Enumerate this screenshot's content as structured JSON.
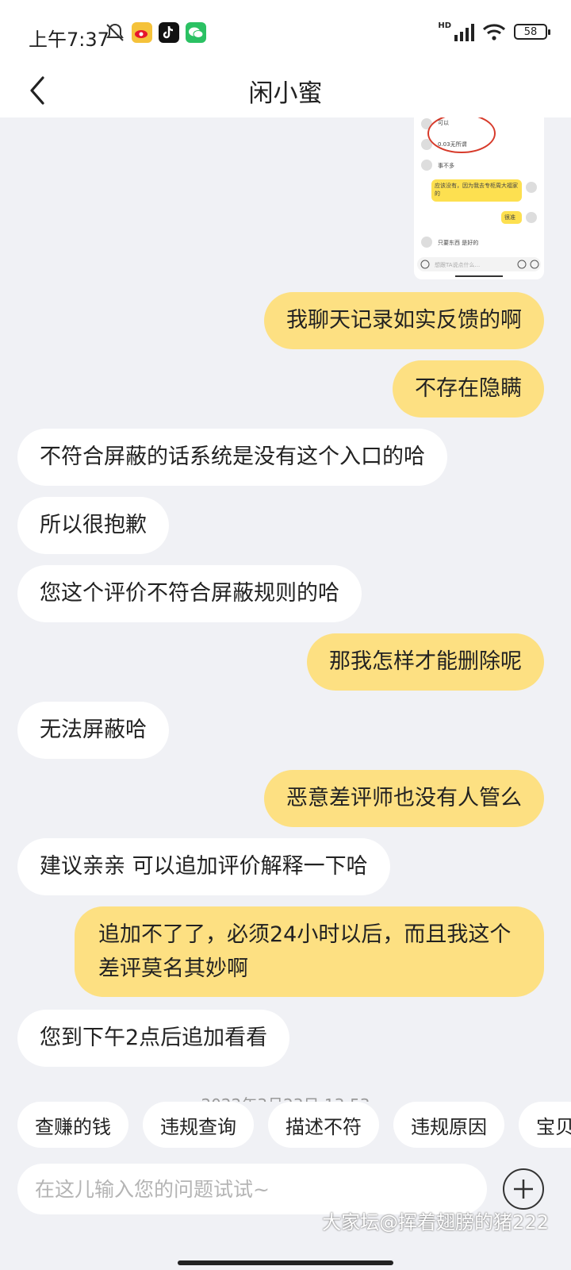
{
  "status_bar": {
    "time": "上午7:37",
    "network": "HD",
    "battery": "58",
    "icons": [
      "mute-icon",
      "weibo-icon",
      "tiktok-icon",
      "wechat-icon"
    ]
  },
  "nav": {
    "title": "闲小蜜"
  },
  "screenshot": {
    "items": [
      "可以",
      "0.03无所谓",
      "事不多",
      "应该没有，因为我去专柜周大福家的",
      "很准",
      "只要东西 是好的"
    ],
    "input_placeholder": "想跟TA说点什么..."
  },
  "messages": [
    {
      "side": "me",
      "text": "我聊天记录如实反馈的啊"
    },
    {
      "side": "me",
      "text": "不存在隐瞒"
    },
    {
      "side": "them",
      "text": "不符合屏蔽的话系统是没有这个入口的哈"
    },
    {
      "side": "them",
      "text": "所以很抱歉"
    },
    {
      "side": "them",
      "text": "您这个评价不符合屏蔽规则的哈"
    },
    {
      "side": "me",
      "text": "那我怎样才能删除呢"
    },
    {
      "side": "them",
      "text": "无法屏蔽哈"
    },
    {
      "side": "me",
      "text": "恶意差评师也没有人管么"
    },
    {
      "side": "them",
      "text": "建议亲亲 可以追加评价解释一下哈"
    },
    {
      "side": "me",
      "text": "追加不了了，必须24小时以后，而且我这个差评莫名其妙啊"
    },
    {
      "side": "them",
      "text": "您到下午2点后追加看看"
    }
  ],
  "timestamp": "2022年3月23日 13:53",
  "quick_replies": [
    "查赚的钱",
    "违规查询",
    "描述不符",
    "违规原因",
    "宝贝"
  ],
  "input": {
    "placeholder": "在这儿输入您的问题试试~"
  },
  "watermark": "大家坛@挥着翅膀的猪222",
  "colors": {
    "my_bubble": "#fde082",
    "their_bubble": "#ffffff",
    "background": "#f0f1f5"
  }
}
